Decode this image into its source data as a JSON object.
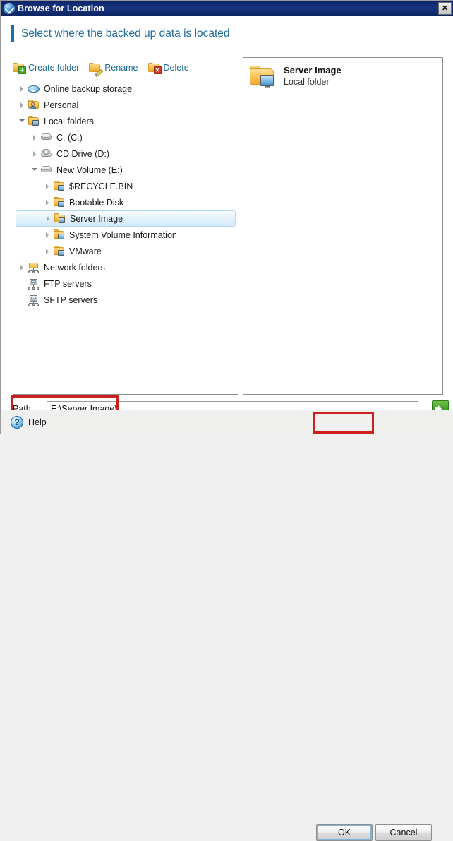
{
  "window": {
    "title": "Browse for Location",
    "logo_icon": "app-logo-icon",
    "close_label": "✕"
  },
  "header": {
    "headline": "Select where the backed up data is located"
  },
  "toolbar": {
    "items": [
      {
        "label": "Create folder",
        "icon": "folder-add-icon"
      },
      {
        "label": "Rename",
        "icon": "folder-pencil-icon"
      },
      {
        "label": "Delete",
        "icon": "folder-delete-icon"
      }
    ]
  },
  "tree": {
    "items": [
      {
        "label": "Online backup storage",
        "icon": "cloud-icon",
        "indent": 0,
        "twisty": "collapsed",
        "selected": false
      },
      {
        "label": "Personal",
        "icon": "personal-folder-icon",
        "indent": 0,
        "twisty": "collapsed",
        "selected": false
      },
      {
        "label": "Local folders",
        "icon": "local-folder-icon",
        "indent": 0,
        "twisty": "expanded",
        "selected": false
      },
      {
        "label": "C: (C:)",
        "icon": "hard-drive-icon",
        "indent": 1,
        "twisty": "collapsed",
        "selected": false
      },
      {
        "label": "CD Drive (D:)",
        "icon": "cd-drive-icon",
        "indent": 1,
        "twisty": "collapsed",
        "selected": false
      },
      {
        "label": "New Volume (E:)",
        "icon": "hard-drive-icon",
        "indent": 1,
        "twisty": "expanded",
        "selected": false
      },
      {
        "label": "$RECYCLE.BIN",
        "icon": "local-folder-icon",
        "indent": 2,
        "twisty": "collapsed",
        "selected": false
      },
      {
        "label": "Bootable Disk",
        "icon": "local-folder-icon",
        "indent": 2,
        "twisty": "collapsed",
        "selected": false
      },
      {
        "label": "Server Image",
        "icon": "local-folder-icon",
        "indent": 2,
        "twisty": "collapsed",
        "selected": true
      },
      {
        "label": "System Volume Information",
        "icon": "local-folder-icon",
        "indent": 2,
        "twisty": "collapsed",
        "selected": false
      },
      {
        "label": "VMware",
        "icon": "local-folder-icon",
        "indent": 2,
        "twisty": "collapsed",
        "selected": false
      },
      {
        "label": "Network folders",
        "icon": "network-folder-icon",
        "indent": 0,
        "twisty": "collapsed",
        "selected": false
      },
      {
        "label": "FTP servers",
        "icon": "server-icon",
        "indent": 0,
        "twisty": "none",
        "selected": false
      },
      {
        "label": "SFTP servers",
        "icon": "server-icon",
        "indent": 0,
        "twisty": "none",
        "selected": false
      }
    ]
  },
  "detail": {
    "icon": "local-folder-large-icon",
    "title": "Server Image",
    "subtitle": "Local folder"
  },
  "path": {
    "label": "Path:",
    "value": "E:\\Server Image\\",
    "placeholder": "",
    "go_icon": "go-arrow-icon"
  },
  "footer": {
    "help_label": "Help",
    "help_icon": "help-icon",
    "ok_label": "OK",
    "cancel_label": "Cancel"
  },
  "colors": {
    "titlebar": "#0a246a",
    "accent": "#1f6b9c",
    "annotation": "#cc1f1f",
    "go_button": "#3f9e24",
    "selection": "#d3e9f9"
  }
}
